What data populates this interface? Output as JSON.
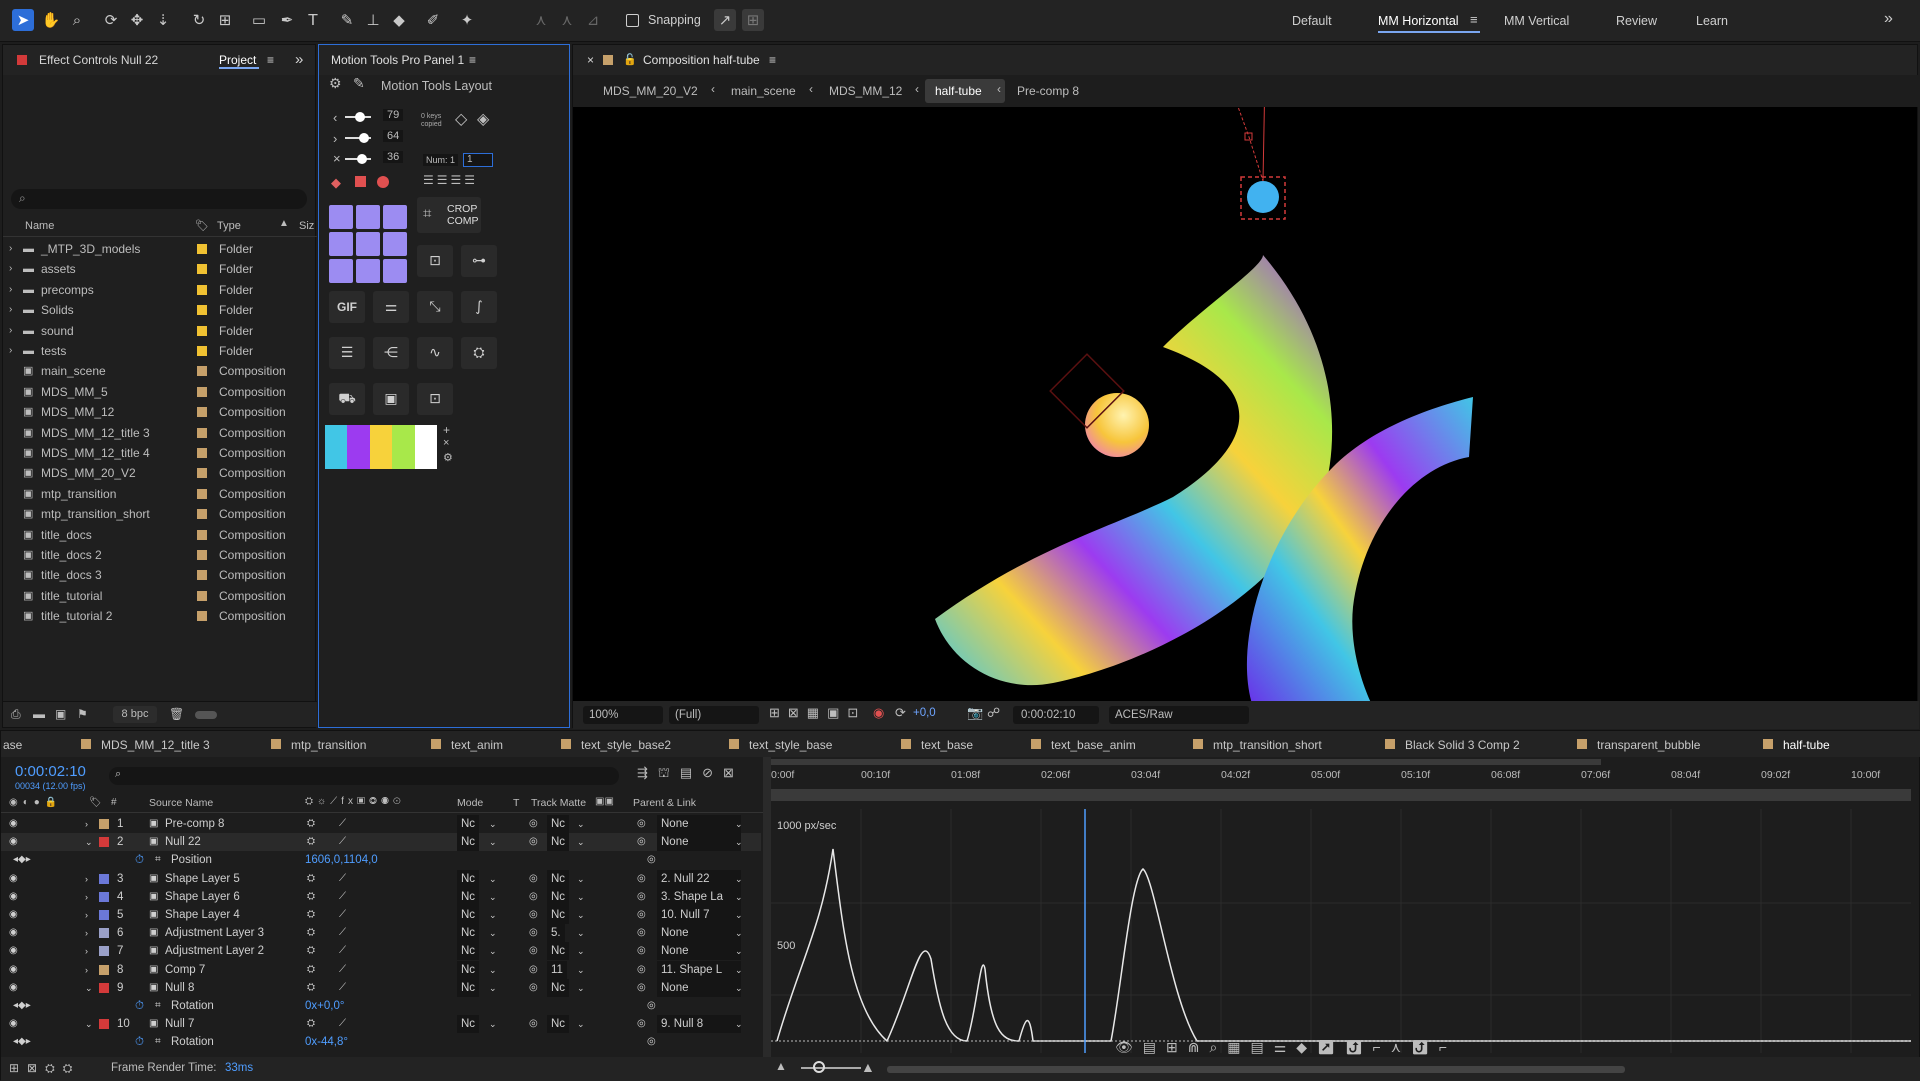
{
  "toolbar": {
    "snapping_label": "Snapping"
  },
  "workspaces": [
    "Default",
    "MM Horizontal",
    "MM Vertical",
    "Review",
    "Learn"
  ],
  "left_panel": {
    "tab_effect": "Effect Controls Null 22",
    "tab_project": "Project",
    "search_placeholder": "",
    "col_name": "Name",
    "col_type": "Type",
    "col_size": "Siz",
    "items": [
      {
        "name": "_MTP_3D_models",
        "type": "Folder",
        "kind": "folder"
      },
      {
        "name": "assets",
        "type": "Folder",
        "kind": "folder"
      },
      {
        "name": "precomps",
        "type": "Folder",
        "kind": "folder"
      },
      {
        "name": "Solids",
        "type": "Folder",
        "kind": "folder"
      },
      {
        "name": "sound",
        "type": "Folder",
        "kind": "folder"
      },
      {
        "name": "tests",
        "type": "Folder",
        "kind": "folder"
      },
      {
        "name": "main_scene",
        "type": "Composition",
        "kind": "comp"
      },
      {
        "name": "MDS_MM_5",
        "type": "Composition",
        "kind": "comp"
      },
      {
        "name": "MDS_MM_12",
        "type": "Composition",
        "kind": "comp"
      },
      {
        "name": "MDS_MM_12_title 3",
        "type": "Composition",
        "kind": "comp"
      },
      {
        "name": "MDS_MM_12_title 4",
        "type": "Composition",
        "kind": "comp"
      },
      {
        "name": "MDS_MM_20_V2",
        "type": "Composition",
        "kind": "comp"
      },
      {
        "name": "mtp_transition",
        "type": "Composition",
        "kind": "comp"
      },
      {
        "name": "mtp_transition_short",
        "type": "Composition",
        "kind": "comp"
      },
      {
        "name": "title_docs",
        "type": "Composition",
        "kind": "comp"
      },
      {
        "name": "title_docs 2",
        "type": "Composition",
        "kind": "comp"
      },
      {
        "name": "title_docs 3",
        "type": "Composition",
        "kind": "comp"
      },
      {
        "name": "title_tutorial",
        "type": "Composition",
        "kind": "comp"
      },
      {
        "name": "title_tutorial 2",
        "type": "Composition",
        "kind": "comp"
      }
    ],
    "bpc": "8 bpc"
  },
  "motion_panel": {
    "title": "Motion Tools Pro Panel 1",
    "layout_label": "Motion Tools Layout",
    "val_top": "79",
    "val_mid": "64",
    "val_bot": "36",
    "keys_copied": "0 keys copied",
    "num_label": "Num: 1",
    "num_value": "1",
    "crop_label_1": "CROP",
    "crop_label_2": "COMP",
    "gif_label": "GIF",
    "palette": [
      "#41c6e6",
      "#9c3bf0",
      "#f7d23b",
      "#a8e84a",
      "#ffffff"
    ]
  },
  "comp": {
    "tab": "Composition half-tube",
    "breadcrumb": [
      "MDS_MM_20_V2",
      "main_scene",
      "MDS_MM_12",
      "half-tube",
      "Pre-comp 8"
    ],
    "zoom": "100%",
    "resolution": "(Full)",
    "exposure": "+0,0",
    "timecode": "0:00:02:10",
    "color": "ACES/Raw"
  },
  "timeline": {
    "tabs": [
      "ase",
      "MDS_MM_12_title 3",
      "mtp_transition",
      "text_anim",
      "text_style_base2",
      "text_style_base",
      "text_base",
      "text_base_anim",
      "mtp_transition_short",
      "Black Solid 3 Comp 2",
      "transparent_bubble",
      "half-tube"
    ],
    "timecode": "0:00:02:10",
    "fps": "00034 (12.00 fps)",
    "headers": {
      "source": "Source Name",
      "mode": "Mode",
      "t": "T",
      "track": "Track Matte",
      "parent": "Parent & Link"
    },
    "ruler": [
      "0:00f",
      "00:10f",
      "01:08f",
      "02:06f",
      "03:04f",
      "04:02f",
      "05:00f",
      "05:10f",
      "06:08f",
      "07:06f",
      "08:04f",
      "09:02f",
      "10:00f"
    ],
    "graph_top": "1000 px/sec",
    "graph_mid": "500",
    "layers": [
      {
        "num": "1",
        "name": "Pre-comp 8",
        "color": "#c6a06a",
        "mode": "Nc",
        "track": "Nc",
        "parent": "None"
      },
      {
        "num": "2",
        "name": "Null 22",
        "color": "#d33a3a",
        "mode": "Nc",
        "track": "Nc",
        "parent": "None"
      },
      {
        "prop": "Position",
        "value": "1606,0,1104,0"
      },
      {
        "num": "3",
        "name": "Shape Layer 5",
        "color": "#6b78d8",
        "mode": "Nc",
        "track": "Nc",
        "parent": "2. Null 22"
      },
      {
        "num": "4",
        "name": "Shape Layer 6",
        "color": "#6b78d8",
        "mode": "Nc",
        "track": "Nc",
        "parent": "3. Shape La"
      },
      {
        "num": "5",
        "name": "Shape Layer 4",
        "color": "#6b78d8",
        "mode": "Nc",
        "track": "Nc",
        "parent": "10. Null 7"
      },
      {
        "num": "6",
        "name": "Adjustment Layer 3",
        "color": "#9aa0c8",
        "mode": "Nc",
        "track": "5.",
        "parent": "None"
      },
      {
        "num": "7",
        "name": "Adjustment Layer 2",
        "color": "#9aa0c8",
        "mode": "Nc",
        "track": "Nc",
        "parent": "None"
      },
      {
        "num": "8",
        "name": "Comp 7",
        "color": "#c6a06a",
        "mode": "Nc",
        "track": "11",
        "parent": "11. Shape L"
      },
      {
        "num": "9",
        "name": "Null 8",
        "color": "#d33a3a",
        "mode": "Nc",
        "track": "Nc",
        "parent": "None"
      },
      {
        "prop": "Rotation",
        "value": "0x+0,0°"
      },
      {
        "num": "10",
        "name": "Null 7",
        "color": "#d33a3a",
        "mode": "Nc",
        "track": "Nc",
        "parent": "9. Null 8"
      },
      {
        "prop": "Rotation",
        "value": "0x-44,8°"
      }
    ],
    "render_time_label": "Frame Render Time:",
    "render_time": "33ms"
  }
}
